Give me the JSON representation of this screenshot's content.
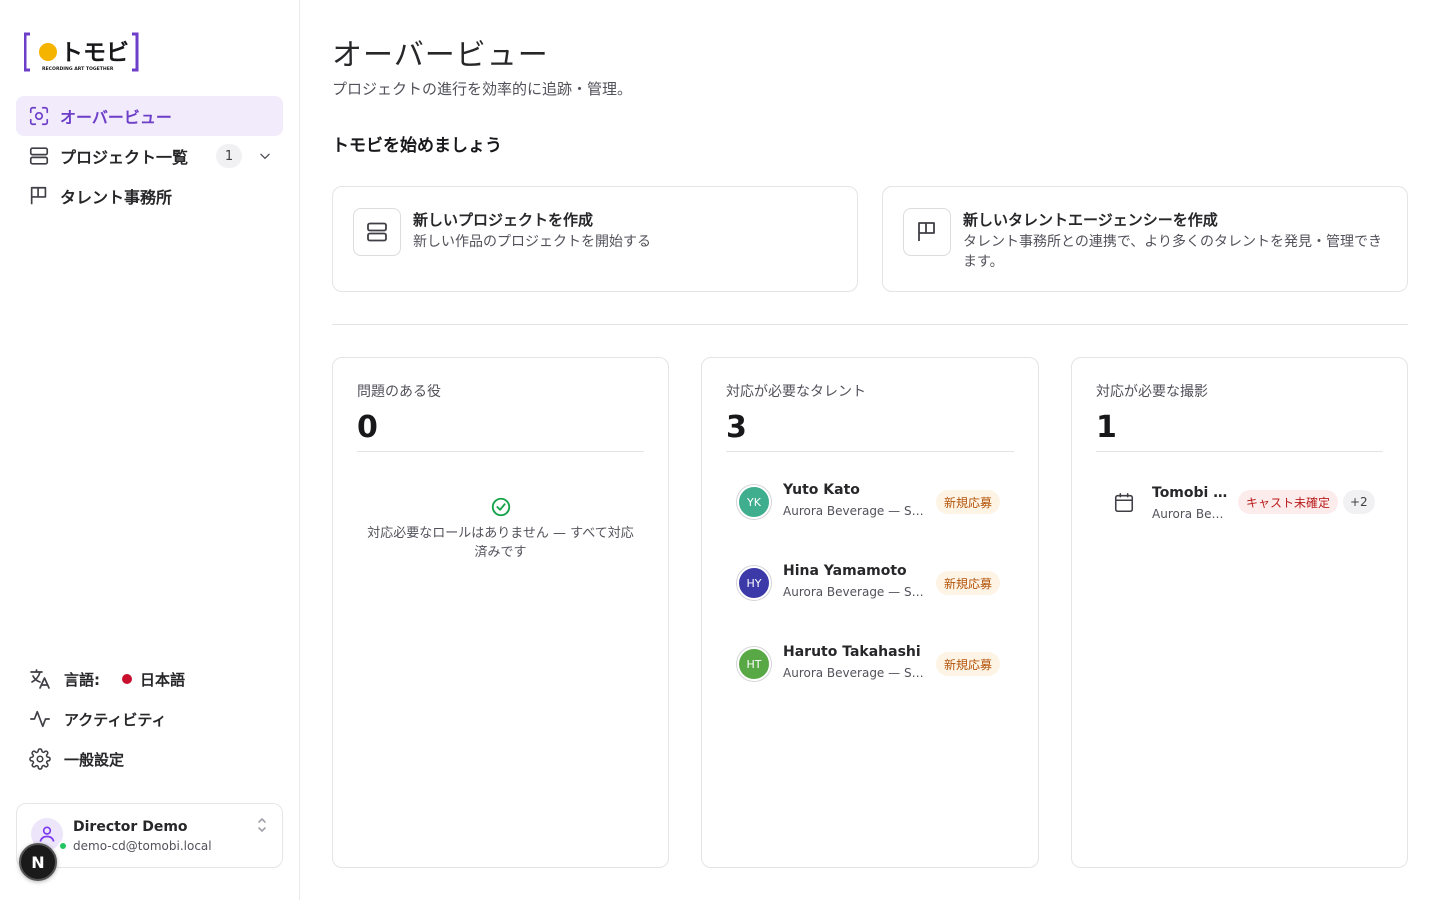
{
  "brand": {
    "logo_text": "トモビ",
    "logo_tagline": "RECORDING ART TOGETHER",
    "accent": "#6d3fc8",
    "logo_dot": "#f5b400"
  },
  "sidebar": {
    "nav": [
      {
        "label": "オーバービュー",
        "icon": "overview-icon",
        "active": true
      },
      {
        "label": "プロジェクト一覧",
        "icon": "projects-icon",
        "count": "1",
        "expandable": true
      },
      {
        "label": "タレント事務所",
        "icon": "flag-icon"
      }
    ],
    "language": {
      "label": "言語:",
      "value": "日本語",
      "icon": "translate-icon"
    },
    "activity": {
      "label": "アクティビティ",
      "icon": "activity-icon"
    },
    "settings": {
      "label": "一般設定",
      "icon": "gear-icon"
    },
    "user": {
      "name": "Director Demo",
      "email": "demo-cd@tomobi.local",
      "status_color": "#22c55e"
    },
    "dev_badge": "N"
  },
  "header": {
    "title": "オーバービュー",
    "subtitle": "プロジェクトの進行を効率的に追跡・管理。"
  },
  "getting_started": {
    "title": "トモビを始めましょう",
    "cards": [
      {
        "title": "新しいプロジェクトを作成",
        "description": "新しい作品のプロジェクトを開始する",
        "icon": "projects-icon"
      },
      {
        "title": "新しいタレントエージェンシーを作成",
        "description": "タレント事務所との連携で、より多くのタレントを発見・管理できます。",
        "icon": "flag-icon"
      }
    ]
  },
  "stats": {
    "roles": {
      "label": "問題のある役",
      "value": "0",
      "empty_text": "対応必要なロールはありません — すべて対応済みです"
    },
    "talents": {
      "label": "対応が必要なタレント",
      "value": "3",
      "items": [
        {
          "initials": "YK",
          "name": "Yuto Kato",
          "subtitle": "Aurora Beverage — Sp…",
          "badge": "新規応募",
          "color": "#3fae8e"
        },
        {
          "initials": "HY",
          "name": "Hina Yamamoto",
          "subtitle": "Aurora Beverage — Sp…",
          "badge": "新規応募",
          "color": "#3b3aa8"
        },
        {
          "initials": "HT",
          "name": "Haruto Takahashi",
          "subtitle": "Aurora Beverage — Sp…",
          "badge": "新規応募",
          "color": "#58a845"
        }
      ]
    },
    "shoots": {
      "label": "対応が必要な撮影",
      "value": "1",
      "items": [
        {
          "name": "Tomobi …",
          "subtitle": "Aurora Bev…",
          "badge": "キャスト未確定",
          "more": "+2",
          "icon": "calendar-icon"
        }
      ]
    }
  }
}
